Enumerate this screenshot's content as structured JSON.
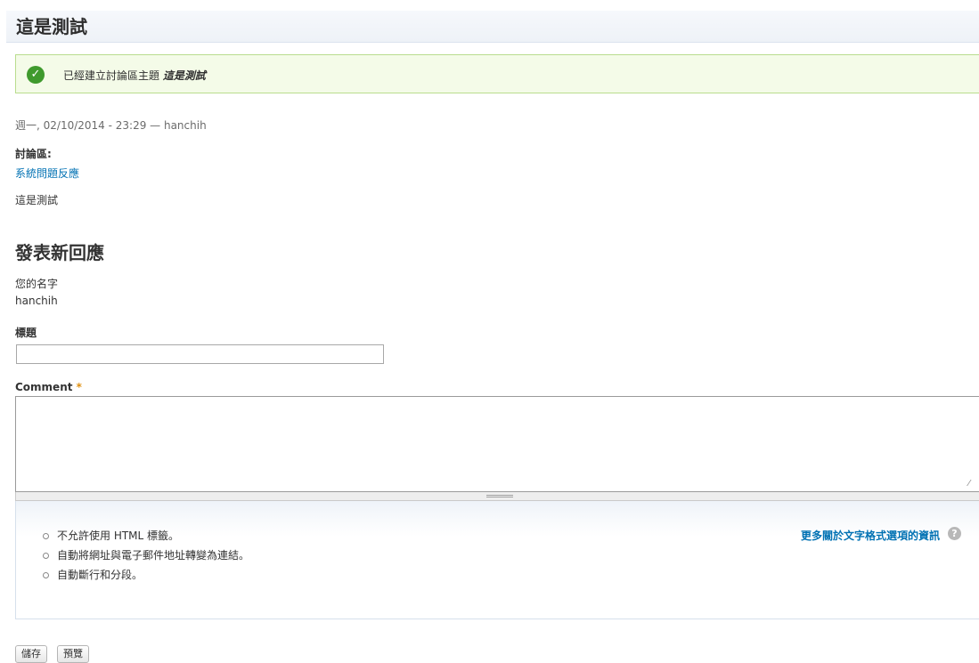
{
  "node": {
    "title": "這是測試",
    "status_prefix": "已經建立討論區主題",
    "status_title": "這是測試",
    "meta": "週一, 02/10/2014 - 23:29 — hanchih",
    "forum_label": "討論區:",
    "forum_link": "系統問題反應",
    "body": "這是測試"
  },
  "comment_form": {
    "heading": "發表新回應",
    "name_label": "您的名字",
    "name_value": "hanchih",
    "subject_label": "標題",
    "subject_value": "",
    "comment_label": "Comment",
    "required_mark": "*",
    "comment_value": "",
    "format_tips": [
      "不允許使用 HTML 標籤。",
      "自動將網址與電子郵件地址轉變為連結。",
      "自動斷行和分段。"
    ],
    "more_info_link": "更多關於文字格式選項的資訊",
    "help_icon": "question-mark-icon",
    "save_label": "儲存",
    "preview_label": "預覽"
  },
  "colors": {
    "link": "#0071b3",
    "status_bg": "#f4fbe8",
    "status_border": "#b9dd8e",
    "check": "#3f9a2d",
    "required": "#e09010"
  }
}
